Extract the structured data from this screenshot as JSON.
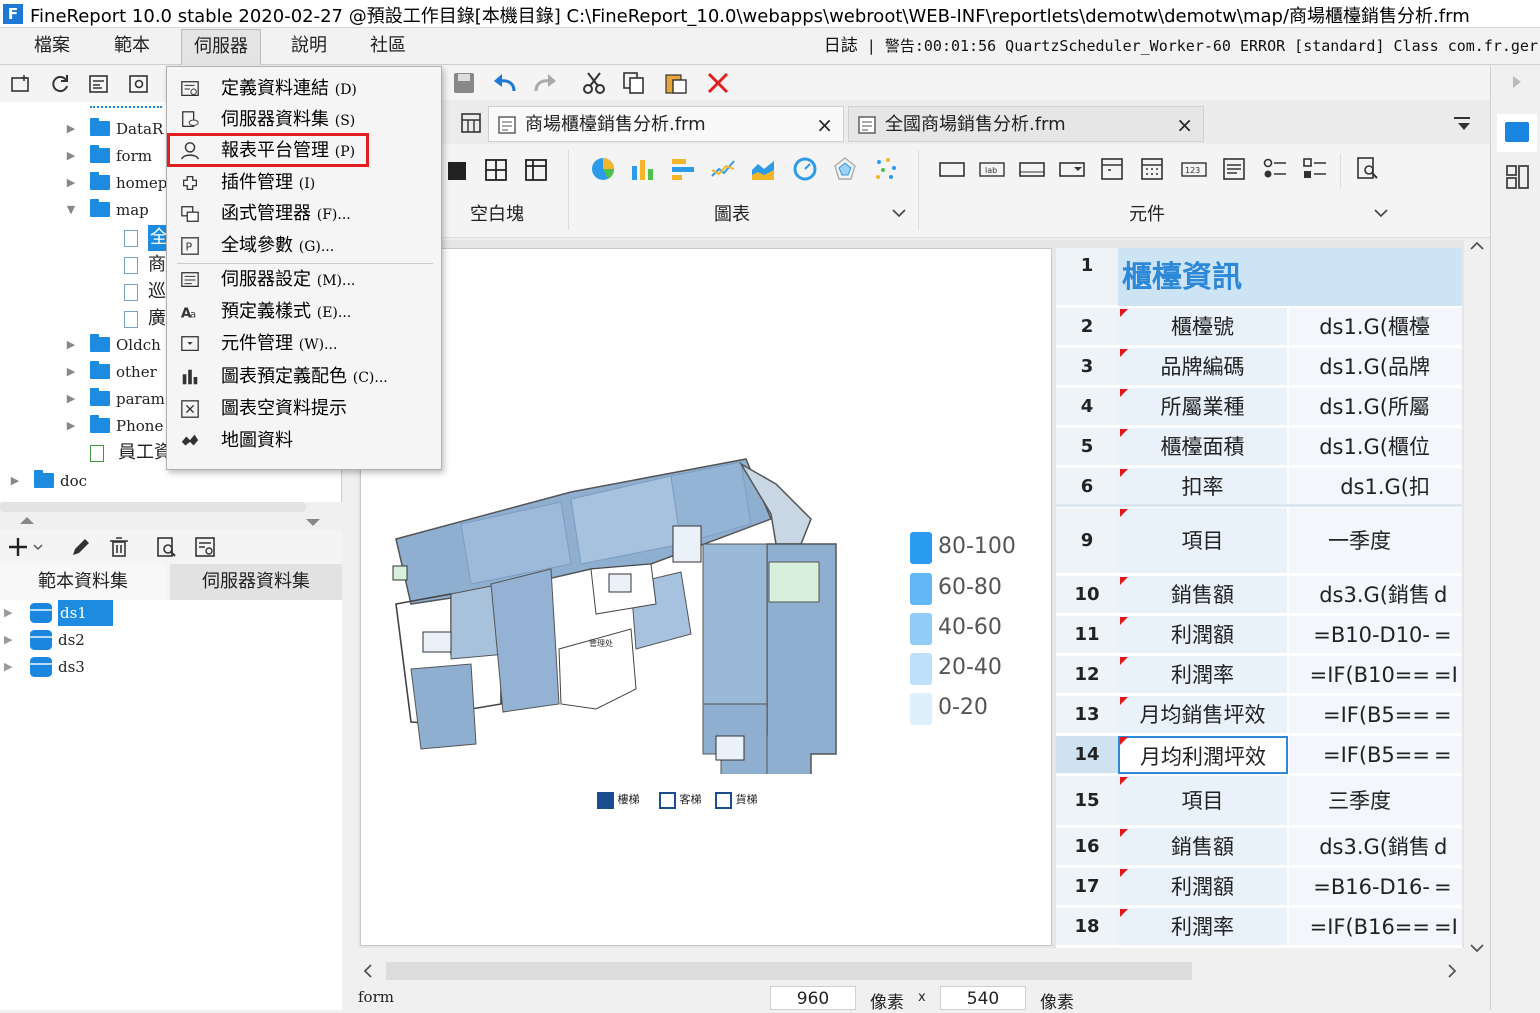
{
  "window": {
    "title": "FineReport 10.0 stable 2020-02-27 @預設工作目錄[本機目錄]    C:\\FineReport_10.0\\webapps\\webroot\\WEB-INF\\reportlets\\demotw\\demotw\\map/商場櫃檯銷售分析.frm"
  },
  "menu": {
    "file": "檔案",
    "template": "範本",
    "server": "伺服器",
    "help": "說明",
    "community": "社區"
  },
  "log": {
    "label": "日誌",
    "text": "警告:00:01:56 QuartzScheduler_Worker-60 ERROR [standard] Class com.fr.ger"
  },
  "tree": {
    "items": [
      "DataR",
      "form",
      "homep",
      "map",
      "全",
      "商",
      "巡",
      "廣",
      "Oldch",
      "other",
      "param",
      "Phone",
      "員工資",
      "doc"
    ]
  },
  "datasets": {
    "tab_template": "範本資料集",
    "tab_server": "伺服器資料集",
    "items": [
      "ds1",
      "ds2",
      "ds3"
    ]
  },
  "dropdown": [
    {
      "label": "定義資料連結",
      "key": "(D)"
    },
    {
      "label": "伺服器資料集",
      "key": "(S)"
    },
    {
      "label": "報表平台管理",
      "key": "(P)"
    },
    {
      "label": "插件管理",
      "key": "(I)"
    },
    {
      "label": "函式管理器",
      "key": "(F)..."
    },
    {
      "label": "全域參數",
      "key": "(G)..."
    },
    {
      "label": "伺服器設定",
      "key": "(M)..."
    },
    {
      "label": "預定義樣式",
      "key": "(E)..."
    },
    {
      "label": "元件管理",
      "key": "(W)..."
    },
    {
      "label": "圖表預定義配色",
      "key": "(C)..."
    },
    {
      "label": "圖表空資料提示",
      "key": ""
    },
    {
      "label": "地圖資料",
      "key": ""
    }
  ],
  "tabs": [
    {
      "label": "商場櫃檯銷售分析.frm",
      "close": "×"
    },
    {
      "label": "全國商場銷售分析.frm",
      "close": "×"
    }
  ],
  "components": {
    "blank": "空白塊",
    "chart": "圖表",
    "widget": "元件"
  },
  "legend": [
    "80-100",
    "60-80",
    "40-60",
    "20-40",
    "0-20"
  ],
  "legend_colors": [
    "#2a9cf2",
    "#62b8f6",
    "#92cdf8",
    "#bfe0fb",
    "#dff0fd"
  ],
  "map_labels": {
    "stairs": "樓梯",
    "elevator": "客梯",
    "freight": "貨梯"
  },
  "grid": {
    "title": "櫃檯資訊",
    "rows": [
      {
        "n": "1",
        "a": "",
        "b": "",
        "c": ""
      },
      {
        "n": "2",
        "a": "櫃檯號",
        "b": "ds1.G(櫃檯",
        "c": ""
      },
      {
        "n": "3",
        "a": "品牌編碼",
        "b": "ds1.G(品牌",
        "c": ""
      },
      {
        "n": "4",
        "a": "所屬業種",
        "b": "ds1.G(所屬",
        "c": ""
      },
      {
        "n": "5",
        "a": "櫃檯面積",
        "b": "ds1.G(櫃位",
        "c": ""
      },
      {
        "n": "6",
        "a": "扣率",
        "b": "ds1.G(扣",
        "c": ""
      },
      {
        "n": "9",
        "a": "項目",
        "b": "一季度",
        "c": ""
      },
      {
        "n": "10",
        "a": "銷售額",
        "b": "ds3.G(銷售",
        "c": "d"
      },
      {
        "n": "11",
        "a": "利潤額",
        "b": "=B10-D10-",
        "c": "="
      },
      {
        "n": "12",
        "a": "利潤率",
        "b": "=IF(B10==",
        "c": "=I"
      },
      {
        "n": "13",
        "a": "月均銷售坪效",
        "b": "=IF(B5==",
        "c": "="
      },
      {
        "n": "14",
        "a": "月均利潤坪效",
        "b": "=IF(B5==",
        "c": "="
      },
      {
        "n": "15",
        "a": "項目",
        "b": "三季度",
        "c": ""
      },
      {
        "n": "16",
        "a": "銷售額",
        "b": "ds3.G(銷售",
        "c": "d"
      },
      {
        "n": "17",
        "a": "利潤額",
        "b": "=B16-D16-",
        "c": "="
      },
      {
        "n": "18",
        "a": "利潤率",
        "b": "=IF(B16==",
        "c": "=I"
      }
    ]
  },
  "status": {
    "mode": "form",
    "width": "960",
    "unit1": "像素",
    "x": "x",
    "height": "540",
    "unit2": "像素"
  }
}
